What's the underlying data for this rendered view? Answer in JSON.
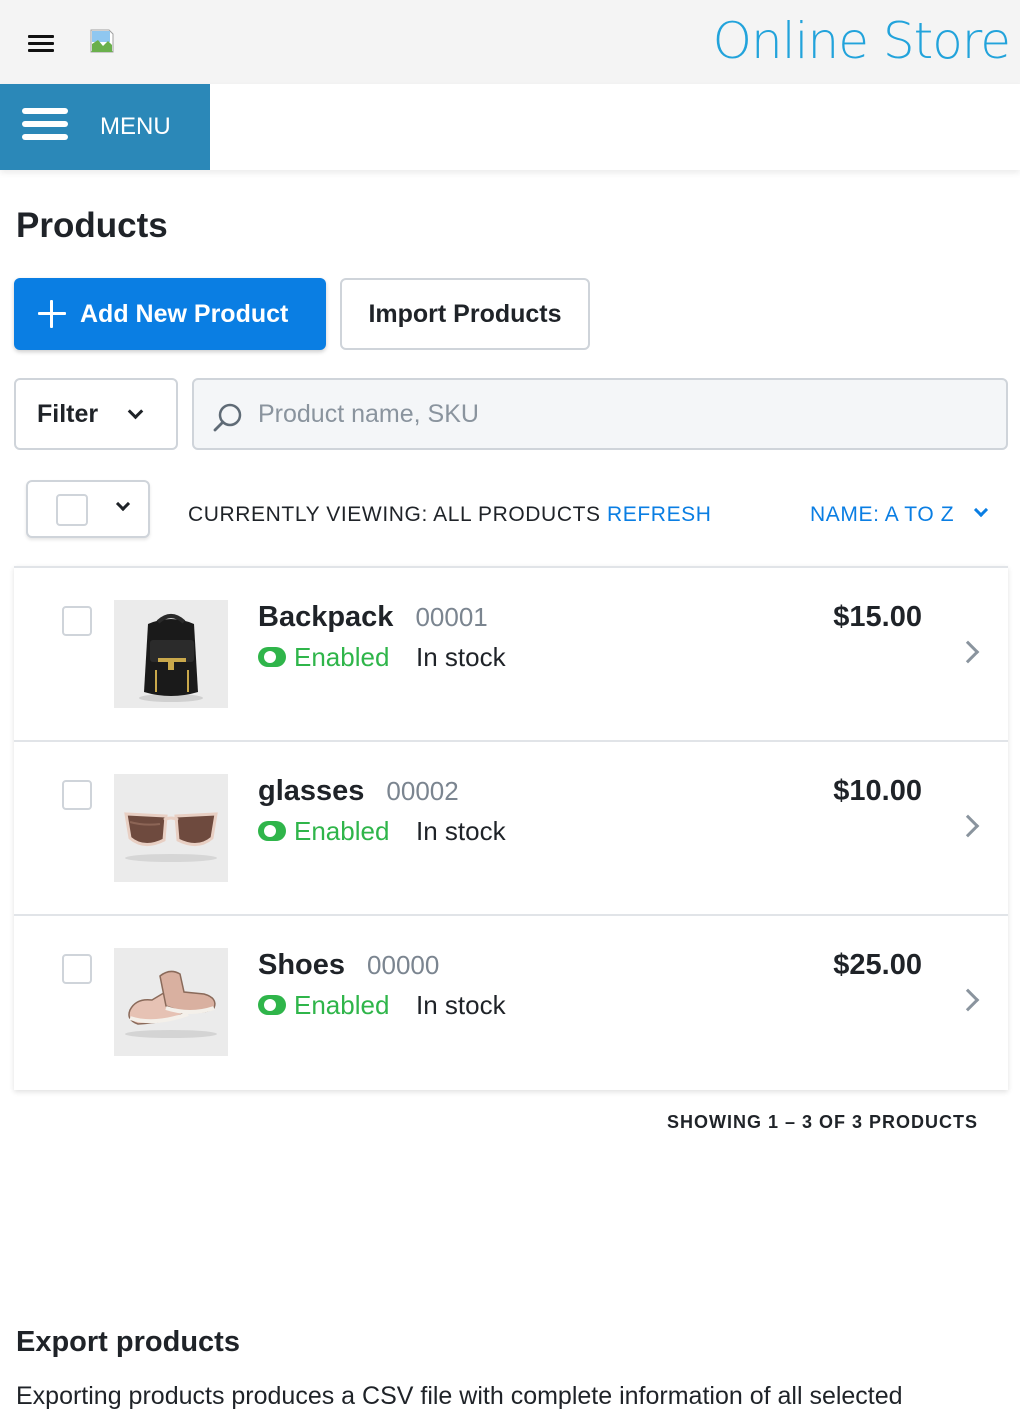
{
  "header": {
    "store_title": "Online Store",
    "brand_color": "#22a3db"
  },
  "menu": {
    "label": "MENU",
    "color": "#2b88b8"
  },
  "page": {
    "title": "Products"
  },
  "actions": {
    "add_label": "Add New Product",
    "import_label": "Import Products",
    "primary_color": "#0a7ee3"
  },
  "filter": {
    "label": "Filter"
  },
  "search": {
    "placeholder": "Product name, SKU",
    "value": ""
  },
  "listing": {
    "viewing": "CURRENTLY VIEWING: ALL PRODUCTS",
    "refresh": "REFRESH",
    "sort": "NAME: A TO Z"
  },
  "products": [
    {
      "name": "Backpack",
      "sku": "00001",
      "status": "Enabled",
      "stock": "In stock",
      "price": "$15.00",
      "image": "backpack"
    },
    {
      "name": "glasses",
      "sku": "00002",
      "status": "Enabled",
      "stock": "In stock",
      "price": "$10.00",
      "image": "sunglasses"
    },
    {
      "name": "Shoes",
      "sku": "00000",
      "status": "Enabled",
      "stock": "In stock",
      "price": "$25.00",
      "image": "shoes"
    }
  ],
  "pagination": {
    "showing": "SHOWING 1 – 3 OF 3 PRODUCTS"
  },
  "export": {
    "title": "Export products",
    "text": "Exporting products produces a CSV file with complete information of all selected"
  },
  "status_color": "#2fb54a"
}
